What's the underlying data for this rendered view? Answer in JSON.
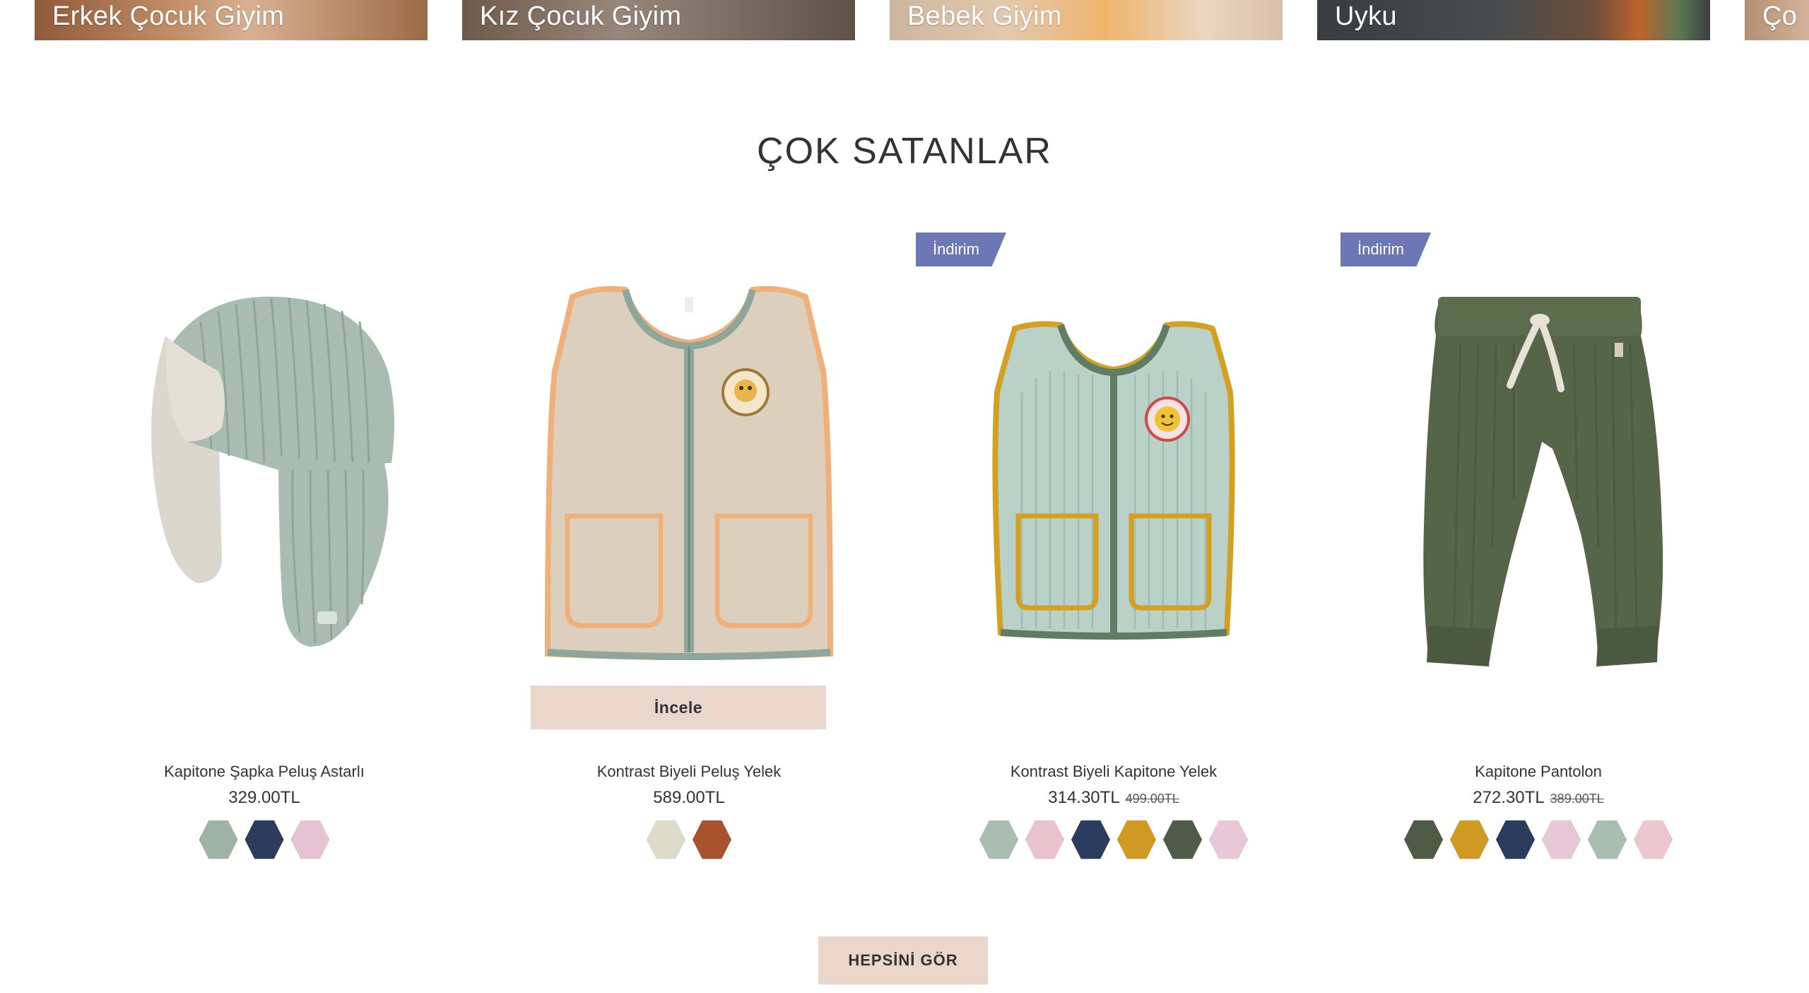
{
  "categories": [
    {
      "label": "Erkek Çocuk Giyim",
      "bg": "#b98a63"
    },
    {
      "label": "Kız Çocuk Giyim",
      "bg": "#8b7a6e"
    },
    {
      "label": "Bebek Giyim",
      "bg": "#d2b7a0"
    },
    {
      "label": "Uyku",
      "bg": "#3f4547"
    },
    {
      "label": "Ço",
      "bg": "#c9a98d"
    }
  ],
  "section": {
    "title": "ÇOK SATANLAR"
  },
  "products": [
    {
      "name": "Kapitone Şapka Peluş Astarlı",
      "price": "329.00TL",
      "old_price": "",
      "badge": "",
      "swatches": [
        "#9fb3a6",
        "#2b3c5e",
        "#e5c3d3"
      ]
    },
    {
      "name": "Kontrast Biyeli Peluş Yelek",
      "price": "589.00TL",
      "old_price": "",
      "badge": "",
      "cta": "İncele",
      "swatches": [
        "#dedbcb",
        "#a8522e"
      ]
    },
    {
      "name": "Kontrast Biyeli Kapitone Yelek",
      "price": "314.30TL",
      "old_price": "499.00TL",
      "badge": "İndirim",
      "swatches": [
        "#a9bdb1",
        "#e8c3cd",
        "#2b3c5e",
        "#d09a22",
        "#4e5b46",
        "#e8c7d6"
      ]
    },
    {
      "name": "Kapitone Pantolon",
      "price": "272.30TL",
      "old_price": "389.00TL",
      "badge": "İndirim",
      "swatches": [
        "#4d5b44",
        "#d09a22",
        "#2b3c5e",
        "#e7c6d6",
        "#a9bdb1",
        "#ebc6cf"
      ]
    }
  ],
  "see_all": "HEPSİNİ GÖR",
  "colors": {
    "badge": "#6c78b5",
    "button_bg": "#ead6ca"
  }
}
